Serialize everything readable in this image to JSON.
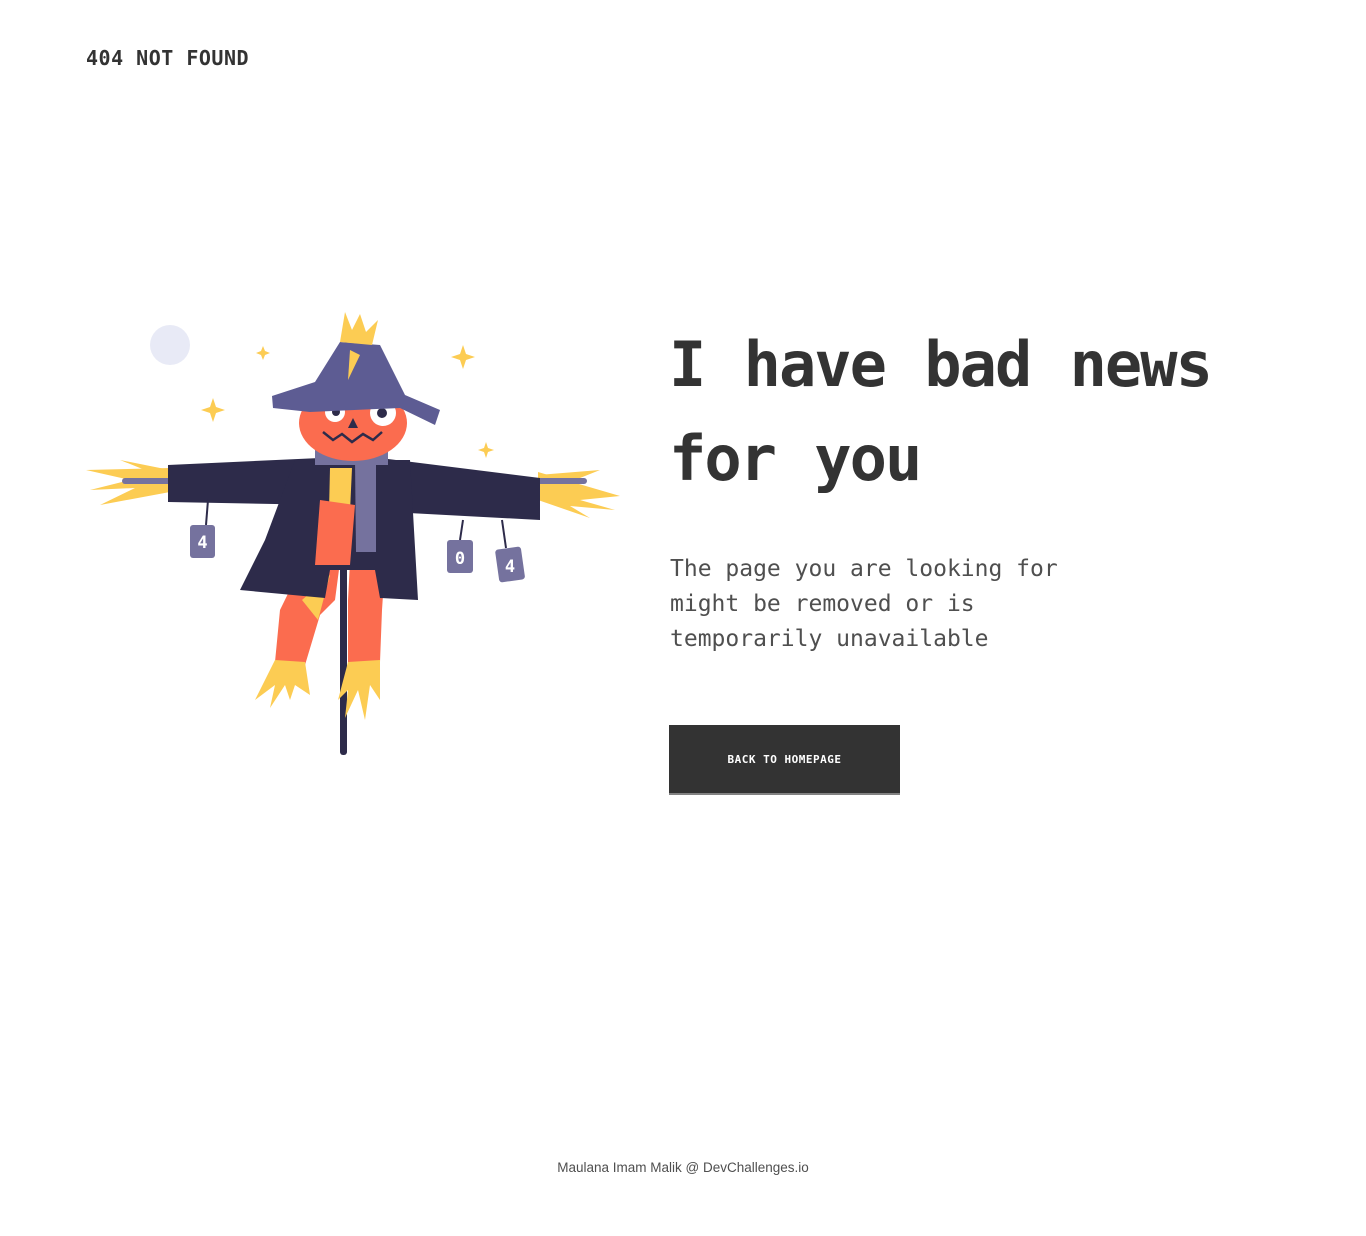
{
  "header": {
    "brand": "404 NOT FOUND"
  },
  "main": {
    "headline": "I have bad news for you",
    "description": "The page you are looking for might be removed or is temporarily unavailable",
    "button_label": "BACK TO HOMEPAGE"
  },
  "illustration": {
    "can_digits": [
      "4",
      "0",
      "4"
    ],
    "colors": {
      "hat": "#5d5c93",
      "face": "#fb6c4f",
      "coat": "#2d2b4a",
      "straw": "#fccc53",
      "scarf": "#75729e",
      "moon": "#e8eaf6",
      "pole": "#2d2b4a"
    }
  },
  "footer": {
    "credit": "Maulana Imam Malik @ DevChallenges.io"
  }
}
